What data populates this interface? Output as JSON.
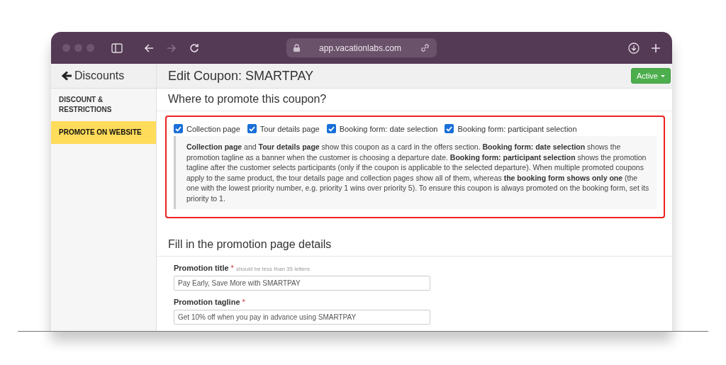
{
  "browser": {
    "url": "app.vacationlabs.com"
  },
  "sidebar": {
    "back_link": "Discounts",
    "items": [
      {
        "label": "DISCOUNT & RESTRICTIONS",
        "selected": false
      },
      {
        "label": "PROMOTE ON WEBSITE",
        "selected": true
      }
    ]
  },
  "header": {
    "title": "Edit Coupon: SMARTPAY",
    "status_button": "Active"
  },
  "promote_section": {
    "heading": "Where to promote this coupon?",
    "options": [
      {
        "label": "Collection page",
        "checked": true
      },
      {
        "label": "Tour details page",
        "checked": true
      },
      {
        "label": "Booking form: date selection",
        "checked": true
      },
      {
        "label": "Booking form: participant selection",
        "checked": true
      }
    ],
    "help_text": "**Collection page** and **Tour details page** show this coupon as a card in the offers section. **Booking form: date selection** shows the promotion tagline as a banner when the customer is choosing a departure date. **Booking form: participant selection** shows the promotion tagline after the customer selects participants (only if the coupon is applicable to the selected departure). When multiple promoted coupons apply to the same product, the tour details page and collection pages show all of them, whereas **the booking form shows only one** (the one with the lowest priority number, e.g. priority 1 wins over priority 5). To ensure this coupon is always promoted on the booking form, set its priority to 1."
  },
  "details_section": {
    "heading": "Fill in the promotion page details",
    "fields": [
      {
        "label": "Promotion title",
        "required_mark": "*",
        "hint": "should be less than 35 letters",
        "value": "Pay Early, Save More with SMARTPAY"
      },
      {
        "label": "Promotion tagline",
        "required_mark": "*",
        "value": "Get 10% off when you pay in advance using SMARTPAY"
      }
    ]
  }
}
